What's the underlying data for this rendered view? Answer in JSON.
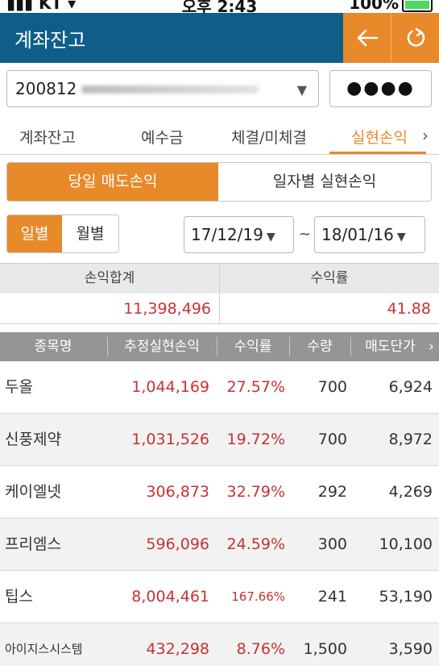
{
  "status_bar": {
    "carrier": "KT",
    "time": "오후 2:43",
    "battery": "100%"
  },
  "header": {
    "title": "계좌잔고",
    "back_icon": "arrow-left-icon",
    "refresh_icon": "refresh-icon"
  },
  "account": {
    "number": "200812",
    "password_mask": "●●●●"
  },
  "tabs": [
    {
      "label": "계좌잔고",
      "active": false
    },
    {
      "label": "예수금",
      "active": false
    },
    {
      "label": "체결/미체결",
      "active": false
    },
    {
      "label": "실현손익",
      "active": true
    }
  ],
  "segment": {
    "left": "당일 매도손익",
    "right": "일자별 실현손익",
    "selected": "left"
  },
  "period": {
    "day": "일별",
    "month": "월별",
    "selected": "day"
  },
  "date_range": {
    "from": "17/12/19",
    "separator": "~",
    "to": "18/01/16"
  },
  "summary": {
    "headers": [
      "손익합계",
      "수익률"
    ],
    "values": [
      "11,398,496",
      "41.88"
    ]
  },
  "table": {
    "headers": [
      "종목명",
      "추정실현손익",
      "수익률",
      "수량",
      "매도단가"
    ],
    "rows": [
      {
        "name": "두올",
        "pl": "1,044,169",
        "rate": "27.57%",
        "qty": "700",
        "price": "6,924"
      },
      {
        "name": "신풍제약",
        "pl": "1,031,526",
        "rate": "19.72%",
        "qty": "700",
        "price": "8,972"
      },
      {
        "name": "케이엘넷",
        "pl": "306,873",
        "rate": "32.79%",
        "qty": "292",
        "price": "4,269"
      },
      {
        "name": "프리엠스",
        "pl": "596,096",
        "rate": "24.59%",
        "qty": "300",
        "price": "10,100"
      },
      {
        "name": "팁스",
        "pl": "8,004,461",
        "rate": "167.66%",
        "qty": "241",
        "price": "53,190"
      },
      {
        "name": "아이지스시스템",
        "pl": "432,298",
        "rate": "8.76%",
        "qty": "1,500",
        "price": "3,590"
      }
    ]
  },
  "colors": {
    "brand_blue": "#0f5e8a",
    "accent_orange": "#e8892a",
    "profit_red": "#c83232",
    "header_gray": "#959595"
  }
}
